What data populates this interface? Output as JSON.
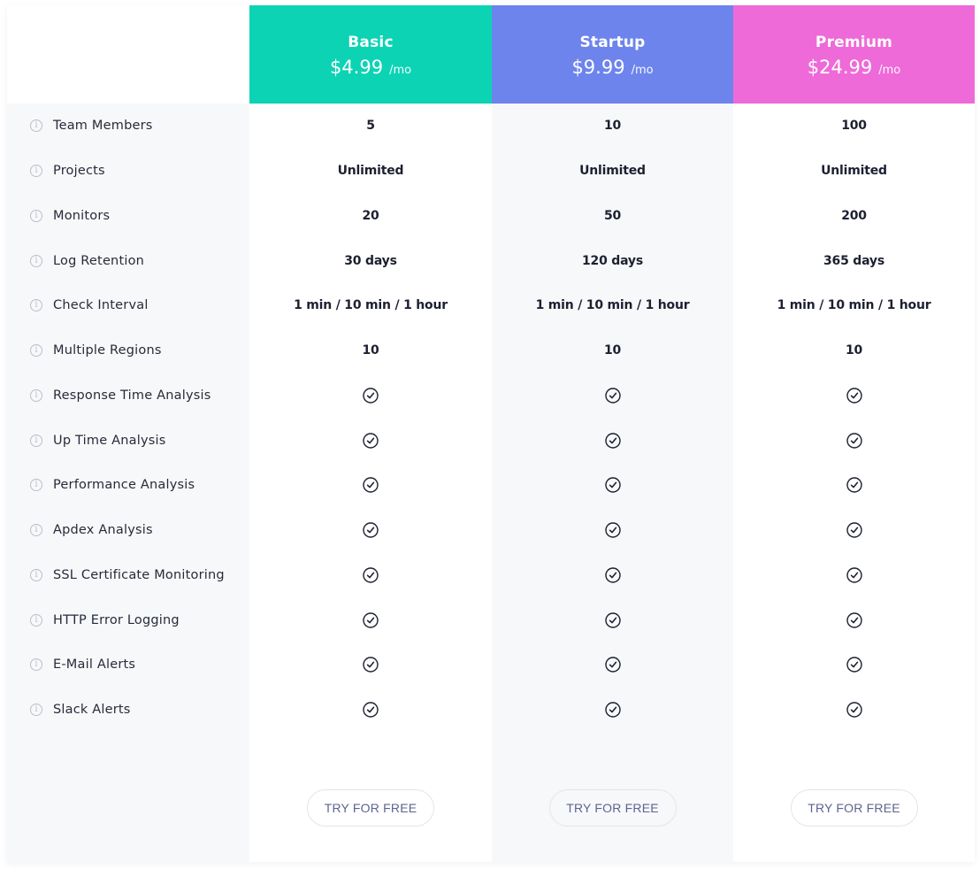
{
  "features": [
    "Team Members",
    "Projects",
    "Monitors",
    "Log Retention",
    "Check Interval",
    "Multiple Regions",
    "Response Time Analysis",
    "Up Time Analysis",
    "Performance Analysis",
    "Apdex Analysis",
    "SSL Certificate Monitoring",
    "HTTP Error Logging",
    "E-Mail Alerts",
    "Slack Alerts"
  ],
  "info_icon": "info-icon",
  "check_icon": "check-circle-icon",
  "plans": [
    {
      "name": "Basic",
      "price": "$4.99",
      "period": "/mo",
      "color": "#0cd3b4",
      "values": [
        "5",
        "Unlimited",
        "20",
        "30 days",
        "1 min / 10 min / 1 hour",
        "10",
        "check",
        "check",
        "check",
        "check",
        "check",
        "check",
        "check",
        "check"
      ],
      "cta": "TRY FOR FREE"
    },
    {
      "name": "Startup",
      "price": "$9.99",
      "period": "/mo",
      "color": "#6d84ec",
      "values": [
        "10",
        "Unlimited",
        "50",
        "120 days",
        "1 min / 10 min / 1 hour",
        "10",
        "check",
        "check",
        "check",
        "check",
        "check",
        "check",
        "check",
        "check"
      ],
      "cta": "TRY FOR FREE"
    },
    {
      "name": "Premium",
      "price": "$24.99",
      "period": "/mo",
      "color": "#ee6ad8",
      "values": [
        "100",
        "Unlimited",
        "200",
        "365 days",
        "1 min / 10 min / 1 hour",
        "10",
        "check",
        "check",
        "check",
        "check",
        "check",
        "check",
        "check",
        "check"
      ],
      "cta": "TRY FOR FREE"
    }
  ]
}
